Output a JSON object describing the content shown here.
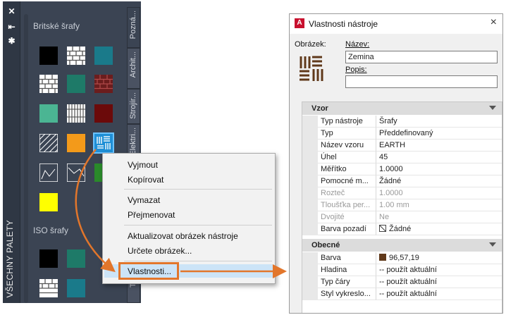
{
  "palette": {
    "vertical_title": "VŠECHNY PALETY",
    "section_british": "Britské šrafy",
    "section_iso": "ISO šrafy",
    "tabs": [
      "Pozná...",
      "Archit...",
      "Strojír...",
      "Elektri...",
      "Tabu..."
    ],
    "colors": {
      "black": "#000000",
      "teal": "#1a7a8a",
      "darkgreen": "#1e7a68",
      "maroon": "#6b1d1d",
      "seagreen": "#4bb593",
      "darkred": "#6b0a0a",
      "orange": "#f39a1a",
      "blue": "#1f8fd6",
      "green": "#2a8a2a",
      "yellow": "#ffff00"
    }
  },
  "context_menu": {
    "items": [
      "Vyjmout",
      "Kopírovat",
      "Vymazat",
      "Přejmenovat",
      "Aktualizovat obrázek nástroje",
      "Určete obrázek...",
      "Vlastnosti..."
    ],
    "highlighted": "Vlastnosti...",
    "accent_color": "#e2762b"
  },
  "dialog": {
    "title": "Vlastnosti nástroje",
    "close": "×",
    "image_label": "Obrázek:",
    "name_label": "Název:",
    "name_value": "Zemina",
    "desc_label": "Popis:",
    "desc_value": "",
    "categories": {
      "pattern": "Vzor",
      "general": "Obecné"
    },
    "pattern_rows": [
      {
        "key": "Typ nástroje",
        "value": "Šrafy",
        "disabled": false
      },
      {
        "key": "Typ",
        "value": "Předdefinovaný",
        "disabled": false
      },
      {
        "key": "Název vzoru",
        "value": "EARTH",
        "disabled": false
      },
      {
        "key": "Úhel",
        "value": "45",
        "disabled": false
      },
      {
        "key": "Měřítko",
        "value": "1.0000",
        "disabled": false
      },
      {
        "key": "Pomocné m...",
        "value": "Žádné",
        "disabled": false
      },
      {
        "key": "Rozteč",
        "value": "1.0000",
        "disabled": true
      },
      {
        "key": "Tloušťka per...",
        "value": "1.00 mm",
        "disabled": true
      },
      {
        "key": "Dvojité",
        "value": "Ne",
        "disabled": true
      },
      {
        "key": "Barva pozadí",
        "value": "Žádné",
        "disabled": false
      }
    ],
    "general_rows": [
      {
        "key": "Barva",
        "value": "96,57,19",
        "disabled": false
      },
      {
        "key": "Hladina",
        "value": "-- použít aktuální",
        "disabled": false
      },
      {
        "key": "Typ čáry",
        "value": "-- použít aktuální",
        "disabled": false
      },
      {
        "key": "Styl vykreslo...",
        "value": "-- použít aktuální",
        "disabled": false
      }
    ],
    "swatch_color": "#60391a"
  }
}
